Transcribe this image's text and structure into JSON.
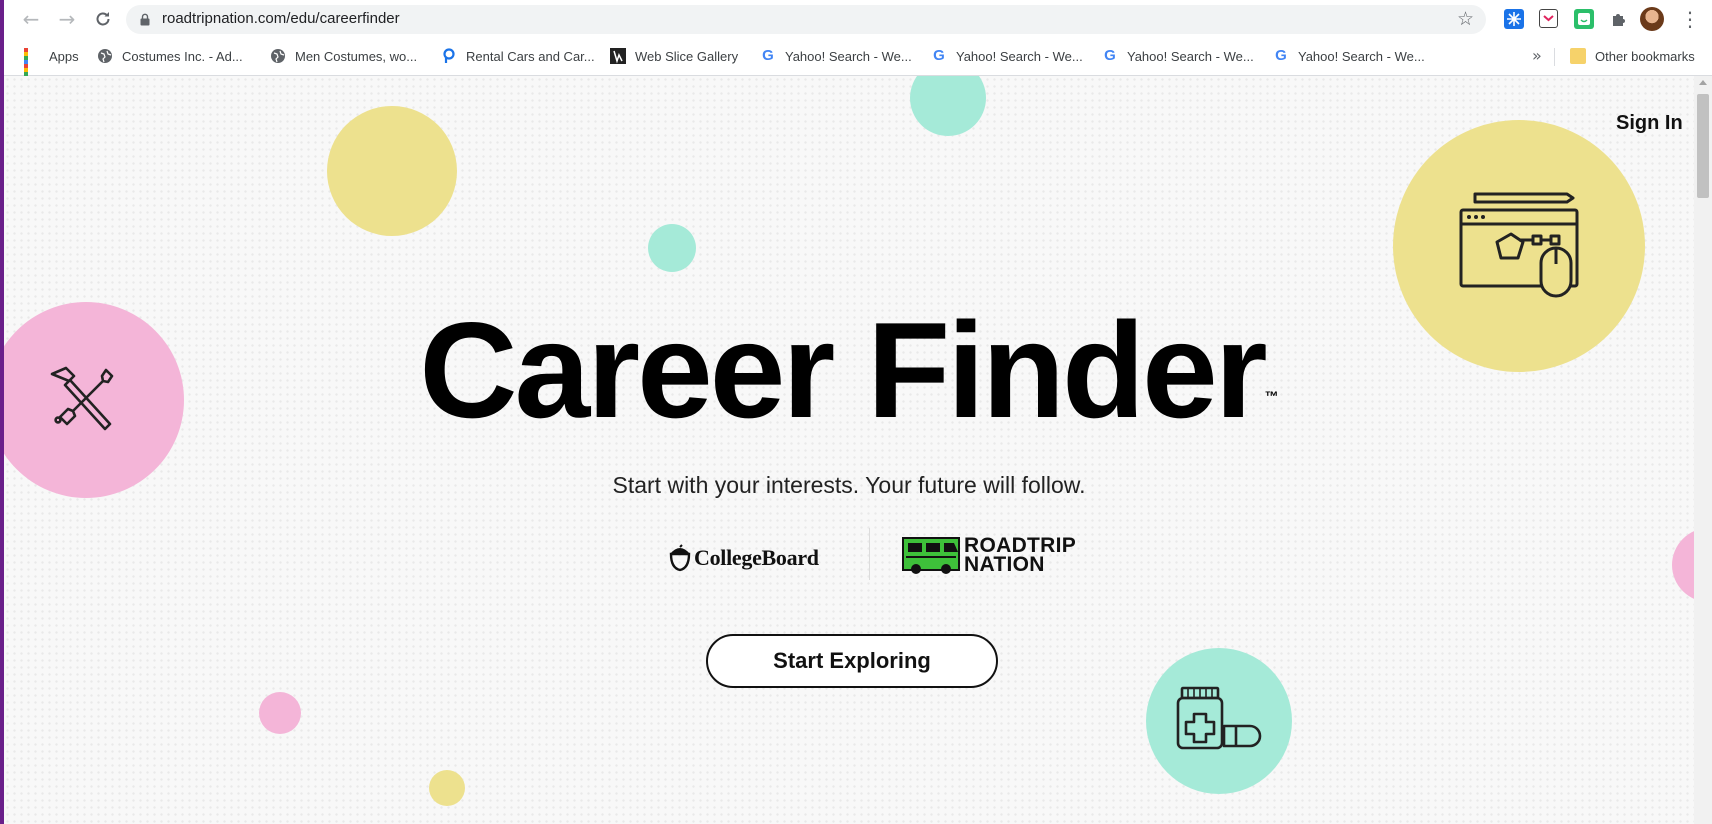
{
  "browser": {
    "url": "roadtripnation.com/edu/careerfinder",
    "icons": {
      "back": "back-arrow-icon",
      "forward": "forward-arrow-icon",
      "reload": "reload-icon",
      "lock": "lock-icon",
      "star": "bookmark-star-icon",
      "extensions": "puzzle-icon",
      "menu": "kebab-menu-icon"
    }
  },
  "bookmarks": {
    "items": [
      {
        "label": "Apps"
      },
      {
        "label": "Costumes Inc. - Ad..."
      },
      {
        "label": "Men Costumes, wo..."
      },
      {
        "label": "Rental Cars and Car..."
      },
      {
        "label": "Web Slice Gallery"
      },
      {
        "label": "Yahoo! Search - We..."
      },
      {
        "label": "Yahoo! Search - We..."
      },
      {
        "label": "Yahoo! Search - We..."
      },
      {
        "label": "Yahoo! Search - We..."
      }
    ],
    "overflow": "»",
    "other": "Other bookmarks"
  },
  "page": {
    "sign_in": "Sign In",
    "title": "Career Finder",
    "trademark": "™",
    "subtitle": "Start with your interests. Your future will follow.",
    "partner1": "CollegeBoard",
    "partner2_line1": "ROADTRIP",
    "partner2_line2": "NATION",
    "cta": "Start Exploring"
  },
  "colors": {
    "yellow": "#ede18e",
    "mint": "#a5ead8",
    "pink": "#f4b5d8",
    "brand_green": "#3ec13a",
    "text": "#111111"
  }
}
